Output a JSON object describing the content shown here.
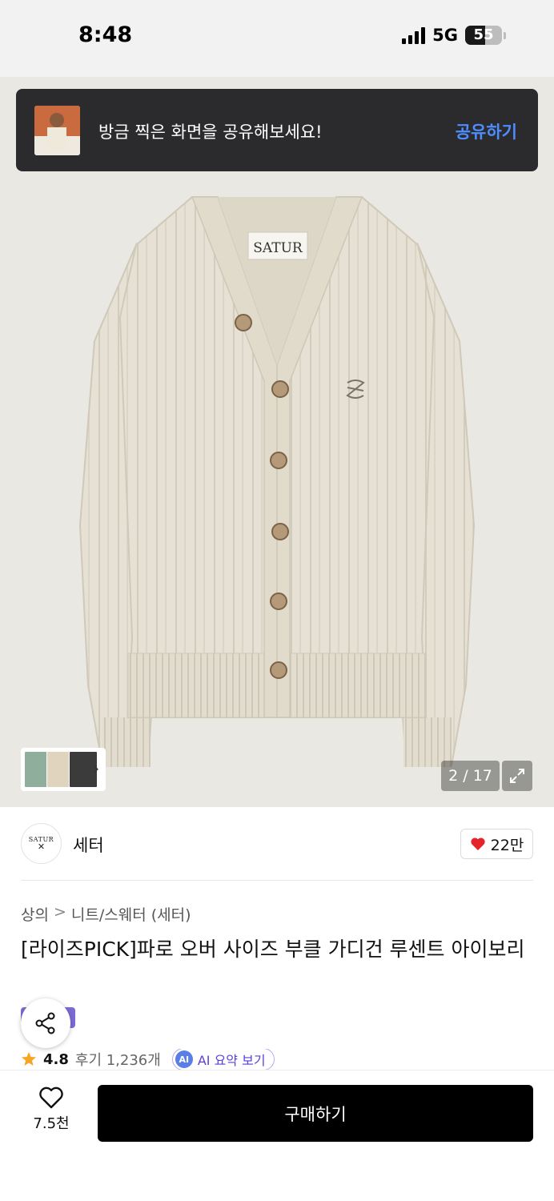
{
  "status_bar": {
    "time": "8:48",
    "network": "5G",
    "battery": "55"
  },
  "toast": {
    "message": "방금 찍은 화면을 공유해보세요!",
    "action": "공유하기"
  },
  "gallery": {
    "counter": "2 / 17",
    "current": 2,
    "total": 17,
    "logo_text": "SATUR"
  },
  "brand": {
    "logo_text": "SATUR",
    "name": "세터",
    "likes": "22만"
  },
  "breadcrumb": {
    "category": "상의",
    "separator": ">",
    "subcategory": "니트/스웨터 (세터)"
  },
  "product": {
    "title": "[라이즈PICK]파로 오버 사이즈 부클 가디건 루센트 아이보리"
  },
  "rating": {
    "score": "4.8",
    "reviews": "후기 1,236개",
    "ai_label": "AI 요약 보기",
    "ai_icon": "AI"
  },
  "bottom_bar": {
    "wish_count": "7.5천",
    "buy_label": "구매하기"
  },
  "colors": {
    "accent_blue": "#4f8dff",
    "heart_red": "#e5232a",
    "star_orange": "#f5a623",
    "ai_purple": "#5b3fd8",
    "buy_button": "#000000"
  }
}
